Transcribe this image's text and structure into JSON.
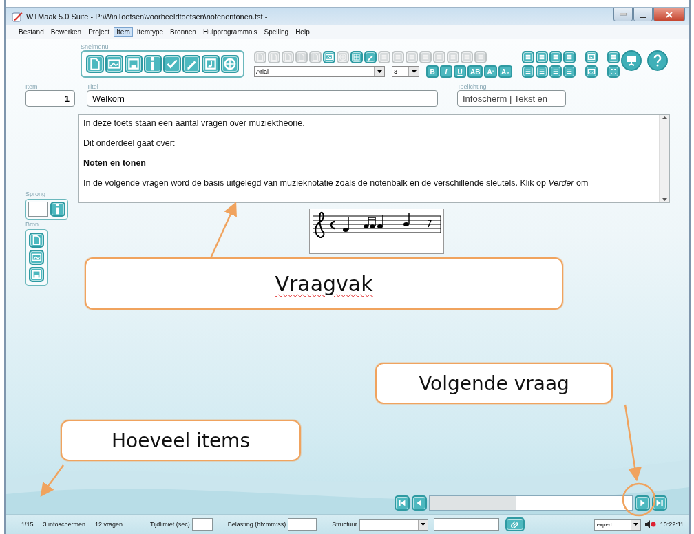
{
  "window": {
    "title": "WTMaak 5.0 Suite - P:\\WinToetsen\\voorbeeldtoetsen\\notenentonen.tst -"
  },
  "menu": [
    {
      "label": "Bestand",
      "selected": false
    },
    {
      "label": "Bewerken",
      "selected": false
    },
    {
      "label": "Project",
      "selected": false
    },
    {
      "label": "Item",
      "selected": true
    },
    {
      "label": "Itemtype",
      "selected": false
    },
    {
      "label": "Bronnen",
      "selected": false
    },
    {
      "label": "Hulpprogramma's",
      "selected": false
    },
    {
      "label": "Spelling",
      "selected": false
    },
    {
      "label": "Help",
      "selected": false
    }
  ],
  "snelmenu": {
    "label": "Snelmenu"
  },
  "format_toolbar": {
    "top_row": [
      {
        "disabled": true
      },
      {
        "disabled": true
      },
      {
        "disabled": true
      },
      {
        "disabled": true
      },
      {
        "disabled": true
      },
      {
        "disabled": false
      },
      {
        "disabled": true
      },
      {
        "disabled": false
      },
      {
        "disabled": false
      },
      {
        "disabled": true
      },
      {
        "disabled": true
      },
      {
        "disabled": true
      },
      {
        "disabled": true
      },
      {
        "disabled": true
      },
      {
        "disabled": true
      },
      {
        "disabled": true
      },
      {
        "disabled": true
      }
    ],
    "font": "Arial",
    "size": "3",
    "style_buttons": [
      "B",
      "I",
      "U",
      "AB",
      "A²",
      "A₂"
    ]
  },
  "fields": {
    "item": {
      "label": "Item",
      "value": "1"
    },
    "titel": {
      "label": "Titel",
      "value": "Welkom"
    },
    "toelichting": {
      "label": "Toelichting",
      "value": "Infoscherm | Tekst en"
    }
  },
  "question_text": [
    {
      "kind": "plain",
      "text": "In deze toets staan een aantal vragen over muziektheorie."
    },
    {
      "kind": "plain",
      "text": "Dit onderdeel gaat over:"
    },
    {
      "kind": "heading",
      "text": "Noten en tonen"
    },
    {
      "kind": "plain",
      "text": "In de volgende vragen word de basis uitgelegd van muzieknotatie zoals de notenbalk en de verschillende sleutels. Klik op *Verder* om"
    }
  ],
  "sprong": {
    "label": "Sprong"
  },
  "bron": {
    "label": "Bron"
  },
  "navigation": {
    "level": 0.43
  },
  "status_bar": {
    "count": "1/15",
    "infoscreens": "3 infoschermen",
    "questions": "12 vragen",
    "time_limit_label": "Tijdlimiet (sec)",
    "load_label": "Belasting (hh:mm:ss)",
    "structure_label": "Structuur",
    "mode": "expert",
    "clock": "10:22:11"
  },
  "callouts": [
    {
      "text": "Vraagvak",
      "spelling_error": true
    },
    {
      "text": "Volgende vraag",
      "spelling_error": false
    },
    {
      "text": "Hoeveel items",
      "spelling_error": false
    }
  ]
}
